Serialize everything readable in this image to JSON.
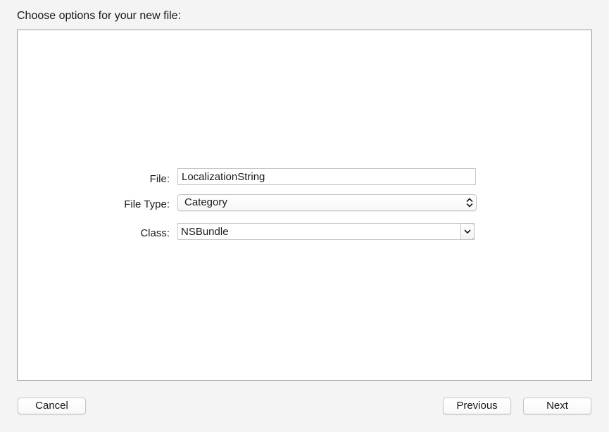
{
  "dialog": {
    "heading": "Choose options for your new file:"
  },
  "form": {
    "file_label": "File:",
    "file_value": "LocalizationString",
    "file_type_label": "File Type:",
    "file_type_value": "Category",
    "class_label": "Class:",
    "class_value": "NSBundle"
  },
  "buttons": {
    "cancel": "Cancel",
    "previous": "Previous",
    "next": "Next"
  },
  "icons": {
    "file_type_popup": "up-down-arrows-icon",
    "class_combo": "chevron-down-icon"
  }
}
